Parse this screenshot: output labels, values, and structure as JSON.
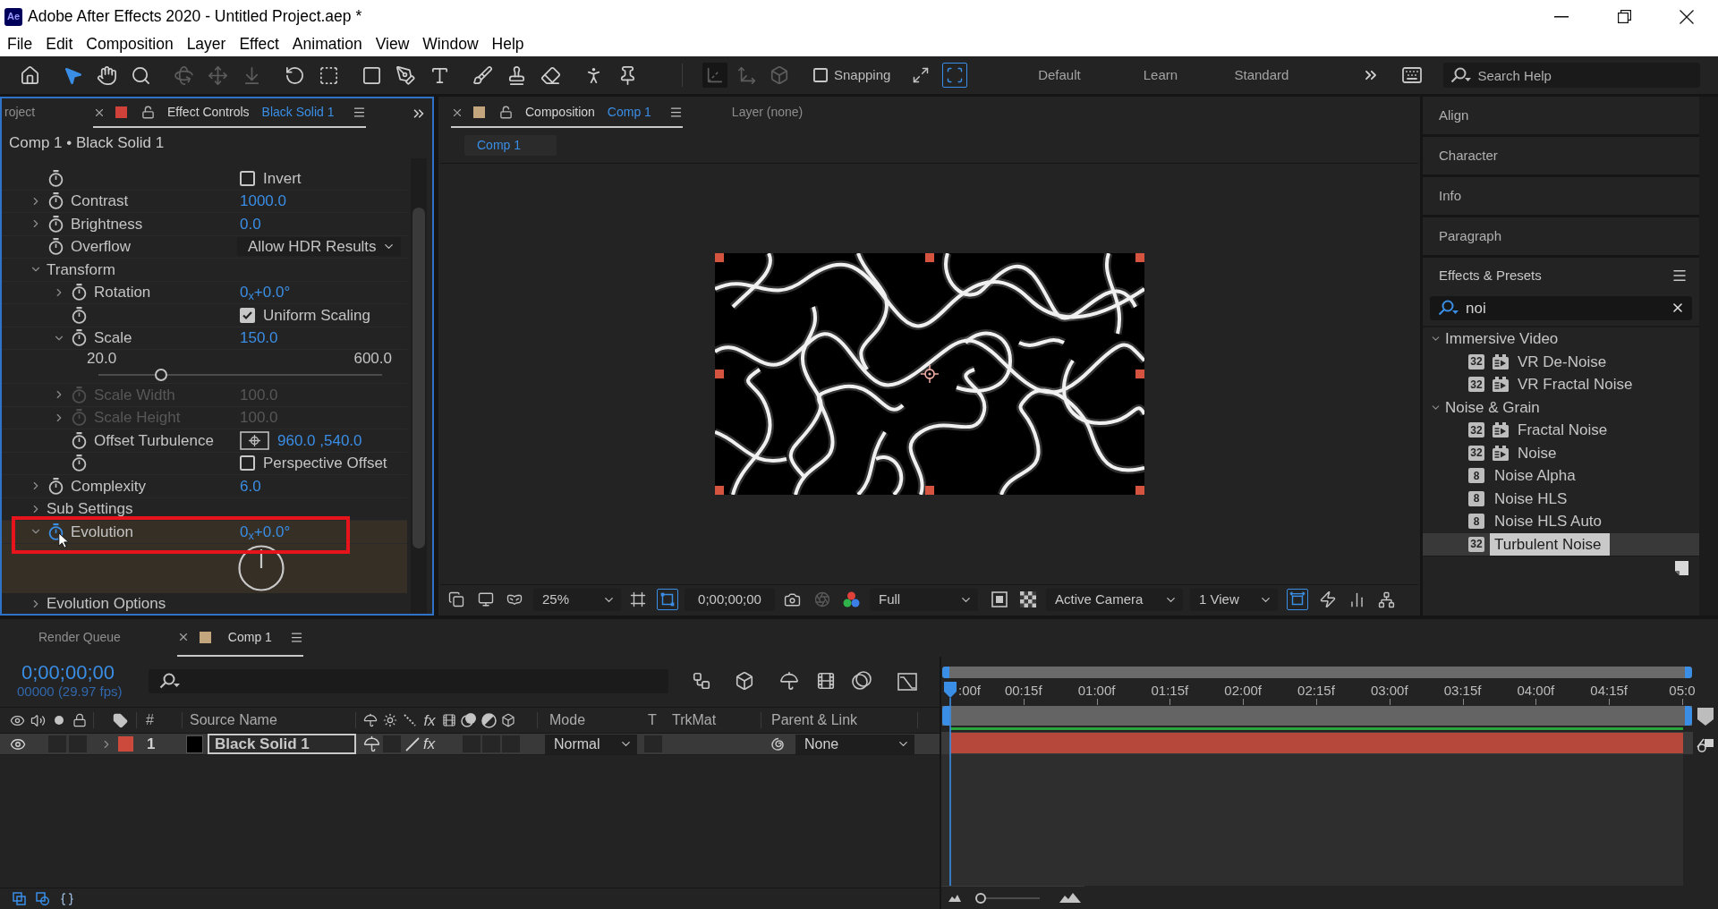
{
  "window": {
    "app_badge": "Ae",
    "title": "Adobe After Effects 2020 - Untitled Project.aep *"
  },
  "menu": [
    "File",
    "Edit",
    "Composition",
    "Layer",
    "Effect",
    "Animation",
    "View",
    "Window",
    "Help"
  ],
  "toolbar": {
    "tool_groups": [
      [
        {
          "kind": "home",
          "selected": false,
          "disabled": false
        }
      ],
      [
        {
          "kind": "selection",
          "selected": true,
          "disabled": false
        },
        {
          "kind": "hand",
          "selected": false,
          "disabled": false
        },
        {
          "kind": "zoom",
          "selected": false,
          "disabled": false
        }
      ],
      [
        {
          "kind": "orbit",
          "selected": false,
          "disabled": true
        },
        {
          "kind": "pan",
          "selected": false,
          "disabled": true
        },
        {
          "kind": "dolly",
          "selected": false,
          "disabled": true
        }
      ],
      [
        {
          "kind": "rotation",
          "selected": false,
          "disabled": false
        },
        {
          "kind": "anchor",
          "selected": false,
          "disabled": false
        }
      ],
      [
        {
          "kind": "rectangle",
          "selected": false,
          "disabled": false
        },
        {
          "kind": "pen",
          "selected": false,
          "disabled": false
        },
        {
          "kind": "type",
          "selected": false,
          "disabled": false
        }
      ],
      [
        {
          "kind": "brush",
          "selected": false,
          "disabled": false
        },
        {
          "kind": "stamp",
          "selected": false,
          "disabled": false
        },
        {
          "kind": "eraser",
          "selected": false,
          "disabled": false
        }
      ],
      [
        {
          "kind": "roto",
          "selected": false,
          "disabled": false
        },
        {
          "kind": "puppet",
          "selected": false,
          "disabled": false
        }
      ]
    ],
    "axis_modes": [
      {
        "kind": "local",
        "selected": true
      },
      {
        "kind": "world",
        "selected": false
      },
      {
        "kind": "view",
        "selected": false
      }
    ],
    "snapping": {
      "label": "Snapping",
      "checked": false
    },
    "snap_options": [
      {
        "kind": "edges",
        "on": false
      },
      {
        "kind": "features",
        "on": true
      }
    ],
    "workspaces": [
      {
        "label": "Default",
        "selected": false
      },
      {
        "label": "Learn",
        "selected": false
      },
      {
        "label": "Standard",
        "selected": false
      }
    ],
    "search": {
      "placeholder": "Search Help"
    }
  },
  "effect_controls": {
    "focused": true,
    "tabs": [
      {
        "label": "roject",
        "selected": false
      },
      {
        "label": "Effect Controls",
        "subject": "Black Solid 1",
        "color": "#d0413a",
        "selected": true
      }
    ],
    "breadcrumb": "Comp 1 • Black Solid 1",
    "properties": [
      {
        "kind": "checkbox",
        "label": "Invert",
        "checked": false,
        "selected": false,
        "annotated": false
      },
      {
        "kind": "number",
        "name": "Contrast",
        "value": "1000.0",
        "expanded": false,
        "selected": false,
        "annotated": false
      },
      {
        "kind": "number",
        "name": "Brightness",
        "value": "0.0",
        "expanded": false,
        "selected": false,
        "annotated": false
      },
      {
        "kind": "dropdown",
        "name": "Overflow",
        "value": "Allow HDR Results",
        "selected": false,
        "annotated": false
      },
      {
        "kind": "group",
        "name": "Transform",
        "expanded": true,
        "selected": false,
        "annotated": false,
        "children": [
          {
            "kind": "angle",
            "name": "Rotation",
            "value": "0$_{x}$+0.0°",
            "expanded": false,
            "disabled": false
          },
          {
            "kind": "checkbox",
            "label": "Uniform Scaling",
            "checked": true,
            "disabled": false
          },
          {
            "kind": "slider",
            "name": "Scale",
            "value": "150.0",
            "expanded": true,
            "min": "20.0",
            "max": "600.0",
            "level": 0.22,
            "disabled": false
          },
          {
            "kind": "number",
            "name": "Scale Width",
            "value": "100.0",
            "expanded": false,
            "disabled": true
          },
          {
            "kind": "number",
            "name": "Scale Height",
            "value": "100.0",
            "expanded": false,
            "disabled": true
          },
          {
            "kind": "point",
            "name": "Offset Turbulence",
            "value": "960.0 ,540.0",
            "disabled": false
          },
          {
            "kind": "checkbox",
            "label": "Perspective Offset",
            "checked": false,
            "disabled": false
          }
        ]
      },
      {
        "kind": "number",
        "name": "Complexity",
        "value": "6.0",
        "expanded": false,
        "selected": false,
        "annotated": false
      },
      {
        "kind": "group",
        "name": "Sub Settings",
        "expanded": false,
        "selected": false,
        "annotated": false
      },
      {
        "kind": "angle",
        "name": "Evolution",
        "value": "0$_{x}$+0.0°",
        "expanded": true,
        "selected": true,
        "annotated": true
      },
      {
        "kind": "group",
        "name": "Evolution Options",
        "expanded": false,
        "selected": false,
        "annotated": false
      }
    ]
  },
  "composition": {
    "tabs": [
      {
        "label": "Composition",
        "subject": "Comp 1",
        "color": "#c4a67e",
        "selected": true
      },
      {
        "label": "Layer (none)",
        "selected": false
      }
    ],
    "breadcrumb": "Comp 1",
    "viewer": {
      "zoom": "25%",
      "masks_shown": true,
      "timecode": "0;00;00;00",
      "resolution": "Full",
      "camera": "Active Camera",
      "views": "1 View",
      "aspect_correction": true
    }
  },
  "side_panels": [
    {
      "title": "Align"
    },
    {
      "title": "Character"
    },
    {
      "title": "Info"
    },
    {
      "title": "Paragraph"
    }
  ],
  "effects_presets": {
    "title": "Effects & Presets",
    "search": {
      "value": "noi"
    },
    "categories": [
      {
        "name": "Immersive Video",
        "expanded": true,
        "children": [
          {
            "name": "VR De-Noise",
            "bit_depth": "32",
            "accelerated": true,
            "selected": false
          },
          {
            "name": "VR Fractal Noise",
            "bit_depth": "32",
            "accelerated": true,
            "selected": false
          }
        ]
      },
      {
        "name": "Noise & Grain",
        "expanded": true,
        "children": [
          {
            "name": "Fractal Noise",
            "bit_depth": "32",
            "accelerated": true,
            "selected": false
          },
          {
            "name": "Noise",
            "bit_depth": "32",
            "accelerated": true,
            "selected": false
          },
          {
            "name": "Noise Alpha",
            "bit_depth": "8",
            "accelerated": false,
            "selected": false
          },
          {
            "name": "Noise HLS",
            "bit_depth": "8",
            "accelerated": false,
            "selected": false
          },
          {
            "name": "Noise HLS Auto",
            "bit_depth": "8",
            "accelerated": false,
            "selected": false
          },
          {
            "name": "Turbulent Noise",
            "bit_depth": "32",
            "accelerated": false,
            "selected": true
          }
        ]
      }
    ]
  },
  "timeline": {
    "tabs": [
      {
        "label": "Render Queue",
        "selected": false
      },
      {
        "label": "Comp 1",
        "color": "#c4a67e",
        "selected": true
      }
    ],
    "timecode": "0;00;00;00",
    "frame_info": "00000 (29.97 fps)",
    "columns": {
      "number": "#",
      "source_name": "Source Name",
      "effects_switch": "fx",
      "mode": "Mode",
      "track_matte_flag": "T",
      "track_matte": "TrkMat",
      "parent": "Parent & Link"
    },
    "layers": [
      {
        "number": "1",
        "name": "Black Solid 1",
        "color": "#cc4a3c",
        "visible": true,
        "expanded": false,
        "editing": true,
        "effects_switch": {
          "label": "fx",
          "on": true
        },
        "mode": "Normal",
        "parent": "None"
      }
    ],
    "ruler": [
      ":00f",
      "00:15f",
      "01:00f",
      "01:15f",
      "02:00f",
      "02:15f",
      "03:00f",
      "03:15f",
      "04:00f",
      "04:15f",
      "05:0"
    ],
    "zoom": {
      "level": 0.05
    }
  }
}
